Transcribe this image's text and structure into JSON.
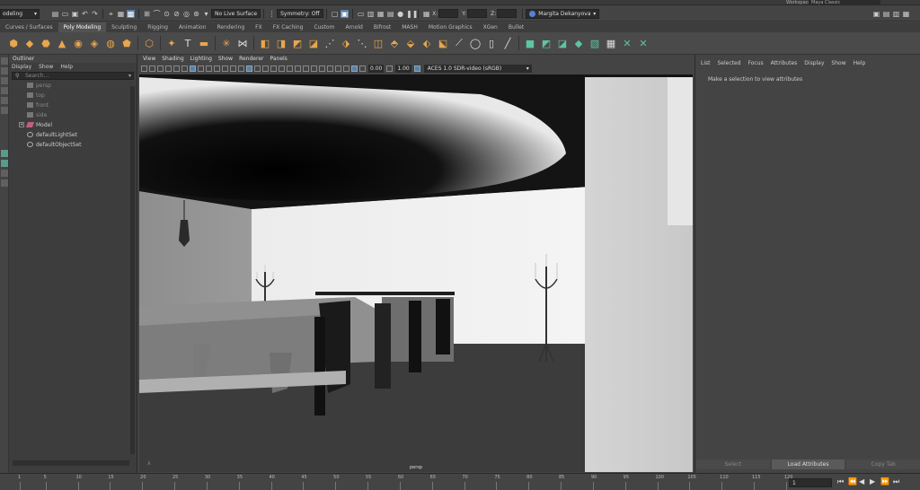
{
  "app": {
    "mode_selector": "odeling",
    "workspace_label": "Workspace :",
    "workspace_value": "Maya Classic"
  },
  "status_line": {
    "live_surface": "No Live Surface",
    "symmetry": "Symmetry: Off",
    "x_label": "X:",
    "y_label": "Y:",
    "z_label": "Z:",
    "user_name": "Margita Dekanyova"
  },
  "shelf_tabs": [
    {
      "label": "Curves / Surfaces",
      "active": false
    },
    {
      "label": "Poly Modeling",
      "active": true
    },
    {
      "label": "Sculpting",
      "active": false
    },
    {
      "label": "Rigging",
      "active": false
    },
    {
      "label": "Animation",
      "active": false
    },
    {
      "label": "Rendering",
      "active": false
    },
    {
      "label": "FX",
      "active": false
    },
    {
      "label": "FX Caching",
      "active": false
    },
    {
      "label": "Custom",
      "active": false
    },
    {
      "label": "Arnold",
      "active": false
    },
    {
      "label": "Bifrost",
      "active": false
    },
    {
      "label": "MASH",
      "active": false
    },
    {
      "label": "Motion Graphics",
      "active": false
    },
    {
      "label": "XGen",
      "active": false
    },
    {
      "label": "Bullet",
      "active": false
    }
  ],
  "outliner": {
    "title": "Outliner",
    "menu": [
      "Display",
      "Show",
      "Help"
    ],
    "search_placeholder": "Search...",
    "items": [
      {
        "label": "persp",
        "dim": true,
        "kind": "camera"
      },
      {
        "label": "top",
        "dim": true,
        "kind": "camera"
      },
      {
        "label": "front",
        "dim": true,
        "kind": "camera"
      },
      {
        "label": "side",
        "dim": true,
        "kind": "camera"
      },
      {
        "label": "Model",
        "dim": false,
        "kind": "group"
      },
      {
        "label": "defaultLightSet",
        "dim": false,
        "kind": "set"
      },
      {
        "label": "defaultObjectSet",
        "dim": false,
        "kind": "set"
      }
    ]
  },
  "viewport": {
    "menu": [
      "View",
      "Shading",
      "Lighting",
      "Show",
      "Renderer",
      "Panels"
    ],
    "exposure": "0.00",
    "gamma": "1.00",
    "color_space": "ACES 1.0 SDR-video (sRGB)",
    "camera_label": "persp"
  },
  "attribute_editor": {
    "menu": [
      "List",
      "Selected",
      "Focus",
      "Attributes",
      "Display",
      "Show",
      "Help"
    ],
    "hint": "Make a selection to view attributes",
    "buttons": [
      {
        "label": "Select",
        "active": false
      },
      {
        "label": "Load Attributes",
        "active": true
      },
      {
        "label": "Copy Tab",
        "active": false
      }
    ]
  },
  "timeline": {
    "ticks": [
      "1",
      "5",
      "10",
      "15",
      "20",
      "25",
      "30",
      "35",
      "40",
      "45",
      "50",
      "55",
      "60",
      "65",
      "70",
      "75",
      "80",
      "85",
      "90",
      "95",
      "100",
      "105",
      "110",
      "115",
      "120"
    ],
    "current_frame": "1"
  },
  "colors": {
    "shelf_icon": "#e8a64d",
    "highlight": "#5a7fa8",
    "panel_bg": "#444444"
  }
}
